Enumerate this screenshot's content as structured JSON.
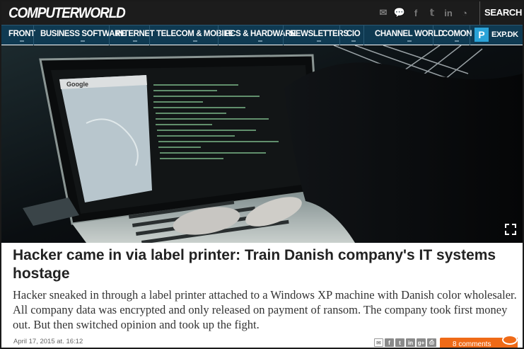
{
  "brand": {
    "logo_text": "COMPUTERWORLD"
  },
  "social_icons": [
    "mail-icon",
    "chat-icon",
    "facebook-icon",
    "twitter-icon",
    "linkedin-icon",
    "rss-icon"
  ],
  "search": {
    "label": "SEARCH"
  },
  "nav": {
    "items": [
      {
        "label": "FRONT"
      },
      {
        "label": "BUSINESS SOFTWARE"
      },
      {
        "label": "INTERNET"
      },
      {
        "label": "TELECOM & MOBILE"
      },
      {
        "label": "PCS & HARDWARE"
      },
      {
        "label": "NEWSLETTERS"
      },
      {
        "label": "CIO"
      },
      {
        "label": "CHANNEL WORLD"
      },
      {
        "label": "COMON"
      }
    ],
    "exp_badge": "P",
    "exp_label": "EXP.DK"
  },
  "article": {
    "headline": "Hacker came in via label printer: Train Danish company's IT systems hostage",
    "lede": "Hacker sneaked in through a label printer attached to a Windows XP machine with Danish color wholesaler. All company data was encrypted and only released on payment of ransom. The company took first money out. But then switched opinion and took up the fight.",
    "date": "April 17, 2015 at. 16:12",
    "comments_label": "8 comments"
  },
  "colors": {
    "topbar": "#1c1c1c",
    "nav": "#0f3a52",
    "accent": "#ef6a17",
    "exp": "#2aa3d8"
  }
}
